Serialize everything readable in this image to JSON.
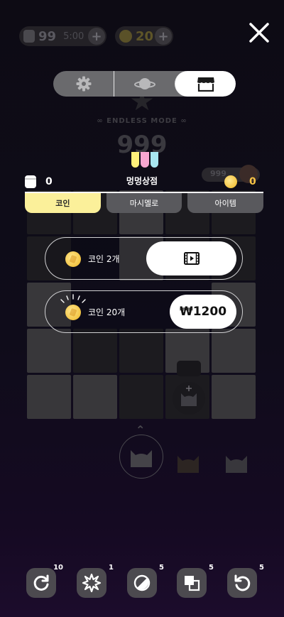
{
  "hud": {
    "energy_value": "99",
    "energy_timer": "5:00",
    "coin_value": "20",
    "plus_symbol": "+"
  },
  "top_tabs": [
    {
      "name": "settings",
      "icon": "gear-icon",
      "active": false
    },
    {
      "name": "planet",
      "icon": "planet-icon",
      "active": false
    },
    {
      "name": "shop",
      "icon": "shop-icon",
      "active": true
    }
  ],
  "background": {
    "mode_label": "∞ ENDLESS MODE ∞",
    "score": "999",
    "best_score": "999"
  },
  "shop": {
    "title": "멍멍상점",
    "cat_food_count": "0",
    "coin_count": "0",
    "tabs": [
      {
        "label": "코인",
        "active": true
      },
      {
        "label": "마시멜로",
        "active": false
      },
      {
        "label": "아이템",
        "active": false
      }
    ],
    "items": [
      {
        "label": "코인 2개",
        "button_type": "watch-ad",
        "button_icon": "film-icon"
      },
      {
        "label": "코인 20개",
        "button_type": "purchase",
        "price": "₩1200"
      }
    ]
  },
  "tools": [
    {
      "icon": "refresh-icon",
      "count": "10"
    },
    {
      "icon": "burst-icon",
      "count": "1"
    },
    {
      "icon": "half-circle-icon",
      "count": "5"
    },
    {
      "icon": "layers-icon",
      "count": "5"
    },
    {
      "icon": "undo-icon",
      "count": "5"
    }
  ],
  "colors": {
    "active_subtab": "#fbf09a",
    "coin_gold": "#f6c445",
    "awning_yellow": "#fff07a",
    "awning_pink": "#f7a6d0",
    "awning_blue": "#a8e6f0"
  }
}
